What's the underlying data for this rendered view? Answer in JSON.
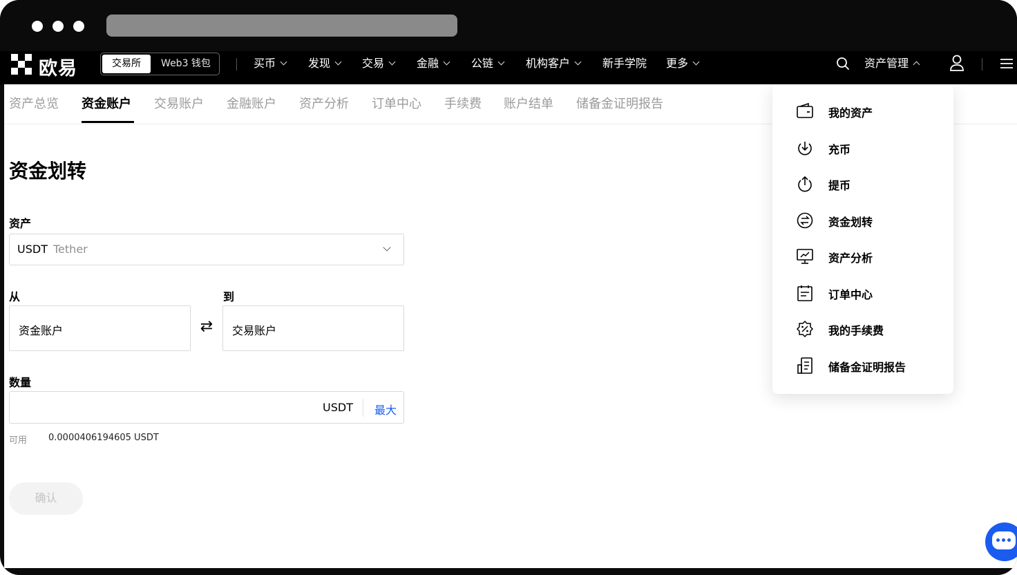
{
  "nav": {
    "logo_text": "欧易",
    "segment": {
      "active": "交易所",
      "inactive": "Web3 钱包"
    },
    "items": [
      "买币",
      "发现",
      "交易",
      "金融",
      "公链",
      "机构客户"
    ],
    "plain_item": "新手学院",
    "more": "更多",
    "asset_management": "资产管理"
  },
  "tabs": [
    "资产总览",
    "资金账户",
    "交易账户",
    "金融账户",
    "资产分析",
    "订单中心",
    "手续费",
    "账户结单",
    "储备金证明报告"
  ],
  "active_tab": "资金账户",
  "form": {
    "title": "资金划转",
    "asset_label": "资产",
    "asset_value": "USDT",
    "asset_name": "Tether",
    "from_label": "从",
    "from_value": "资金账户",
    "to_label": "到",
    "to_value": "交易账户",
    "quantity_label": "数量",
    "quantity_unit": "USDT",
    "max_label": "最大",
    "available_label": "可用",
    "available_value": "0.0000406194605 USDT",
    "confirm_label": "确认"
  },
  "dropdown": {
    "items": [
      {
        "label": "我的资产",
        "icon": "wallet-icon"
      },
      {
        "label": "充币",
        "icon": "deposit-icon"
      },
      {
        "label": "提币",
        "icon": "withdraw-icon"
      },
      {
        "label": "资金划转",
        "icon": "transfer-icon"
      },
      {
        "label": "资产分析",
        "icon": "analysis-icon"
      },
      {
        "label": "订单中心",
        "icon": "order-icon"
      },
      {
        "label": "我的手续费",
        "icon": "fee-icon"
      },
      {
        "label": "储备金证明报告",
        "icon": "report-icon"
      }
    ]
  },
  "colors": {
    "accent": "#1a5cf0",
    "nav_bg": "#000000",
    "muted": "#9b9b9b"
  }
}
